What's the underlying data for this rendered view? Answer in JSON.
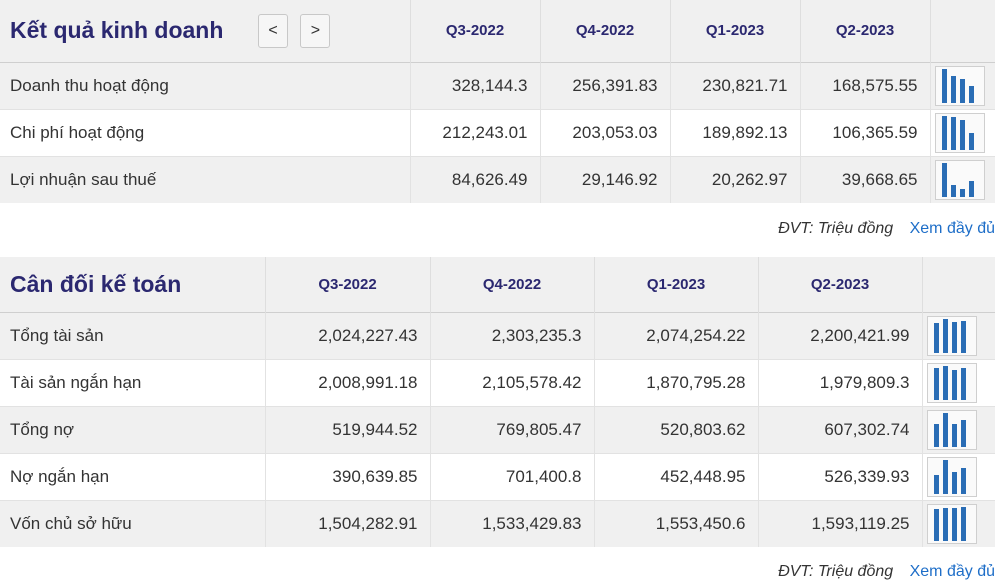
{
  "business_results": {
    "title": "Kết quả kinh doanh",
    "nav_prev": "<",
    "nav_next": ">",
    "periods": [
      "Q3-2022",
      "Q4-2022",
      "Q1-2023",
      "Q2-2023"
    ],
    "rows": [
      {
        "label": "Doanh thu hoạt động",
        "values": [
          "328,144.3",
          "256,391.83",
          "230,821.71",
          "168,575.55"
        ],
        "spark": [
          328144.3,
          256391.83,
          230821.71,
          168575.55
        ]
      },
      {
        "label": "Chi phí hoạt động",
        "values": [
          "212,243.01",
          "203,053.03",
          "189,892.13",
          "106,365.59"
        ],
        "spark": [
          212243.01,
          203053.03,
          189892.13,
          106365.59
        ]
      },
      {
        "label": "Lợi nhuận sau thuế",
        "values": [
          "84,626.49",
          "29,146.92",
          "20,262.97",
          "39,668.65"
        ],
        "spark": [
          84626.49,
          29146.92,
          20262.97,
          39668.65
        ]
      }
    ],
    "unit_note": "ĐVT: Triệu đồng",
    "more_link": "Xem đầy đủ"
  },
  "balance_sheet": {
    "title": "Cân đối kế toán",
    "periods": [
      "Q3-2022",
      "Q4-2022",
      "Q1-2023",
      "Q2-2023"
    ],
    "rows": [
      {
        "label": "Tổng tài sản",
        "values": [
          "2,024,227.43",
          "2,303,235.3",
          "2,074,254.22",
          "2,200,421.99"
        ],
        "spark": [
          2024227.43,
          2303235.3,
          2074254.22,
          2200421.99
        ]
      },
      {
        "label": "Tài sản ngắn hạn",
        "values": [
          "2,008,991.18",
          "2,105,578.42",
          "1,870,795.28",
          "1,979,809.3"
        ],
        "spark": [
          2008991.18,
          2105578.42,
          1870795.28,
          1979809.3
        ]
      },
      {
        "label": "Tổng nợ",
        "values": [
          "519,944.52",
          "769,805.47",
          "520,803.62",
          "607,302.74"
        ],
        "spark": [
          519944.52,
          769805.47,
          520803.62,
          607302.74
        ]
      },
      {
        "label": "Nợ ngắn hạn",
        "values": [
          "390,639.85",
          "701,400.8",
          "452,448.95",
          "526,339.93"
        ],
        "spark": [
          390639.85,
          701400.8,
          452448.95,
          526339.93
        ]
      },
      {
        "label": "Vốn chủ sở hữu",
        "values": [
          "1,504,282.91",
          "1,533,429.83",
          "1,553,450.6",
          "1,593,119.25"
        ],
        "spark": [
          1504282.91,
          1533429.83,
          1553450.6,
          1593119.25
        ]
      }
    ],
    "unit_note": "ĐVT: Triệu đồng",
    "more_link": "Xem đầy đủ"
  },
  "colors": {
    "title": "#2b2870",
    "bar": "#2a6db5",
    "link": "#1e6ec8",
    "row_shade": "#f0f0f0"
  }
}
